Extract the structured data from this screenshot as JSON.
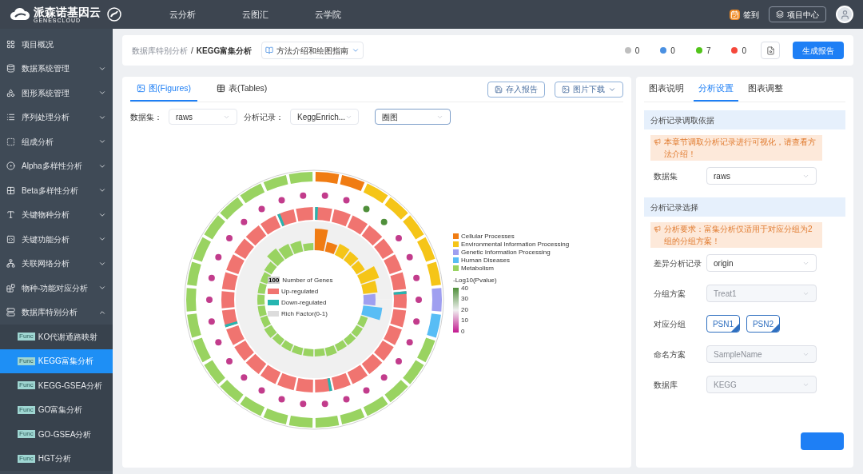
{
  "header": {
    "logo_text": "派森诺基因云",
    "logo_sub": "GENESCLOUD",
    "nav": [
      "云分析",
      "云图汇",
      "云学院"
    ],
    "sign_in": "签到",
    "project_center": "项目中心"
  },
  "sidebar": {
    "items": [
      {
        "kind": "link",
        "label": "项目概况"
      },
      {
        "kind": "group",
        "label": "数据系统管理",
        "expanded": false
      },
      {
        "kind": "group",
        "label": "图形系统管理",
        "expanded": false
      },
      {
        "kind": "group",
        "label": "序列处理分析",
        "expanded": false
      },
      {
        "kind": "group",
        "label": "组成分析",
        "expanded": false
      },
      {
        "kind": "group",
        "label": "Alpha多样性分析",
        "expanded": false
      },
      {
        "kind": "group",
        "label": "Beta多样性分析",
        "expanded": false
      },
      {
        "kind": "group",
        "label": "关键物种分析",
        "expanded": false
      },
      {
        "kind": "group",
        "label": "关键功能分析",
        "expanded": false
      },
      {
        "kind": "group",
        "label": "关联网络分析",
        "expanded": false
      },
      {
        "kind": "group",
        "label": "物种-功能对应分析",
        "expanded": false
      },
      {
        "kind": "group",
        "label": "数据库特别分析",
        "expanded": true,
        "children": [
          {
            "badge": "Func",
            "label": "KO代谢通路映射",
            "selected": false
          },
          {
            "badge": "Func",
            "label": "KEGG富集分析",
            "selected": true
          },
          {
            "badge": "Func",
            "label": "KEGG-GSEA分析",
            "selected": false
          },
          {
            "badge": "Func",
            "label": "GO富集分析",
            "selected": false
          },
          {
            "badge": "Func",
            "label": "GO-GSEA分析",
            "selected": false
          },
          {
            "badge": "Func",
            "label": "HGT分析",
            "selected": false
          }
        ]
      }
    ]
  },
  "breadcrumb": {
    "parent": "数据库特别分析",
    "separator": "/",
    "current": "KEGG富集分析",
    "guide": "方法介绍和绘图指南",
    "status": [
      {
        "color": "#bfbfbf",
        "count": "0"
      },
      {
        "color": "#4a90e2",
        "count": "0"
      },
      {
        "color": "#52c41a",
        "count": "7"
      },
      {
        "color": "#f5483b",
        "count": "0"
      }
    ],
    "generate": "生成报告"
  },
  "main": {
    "tabs": [
      {
        "label": "图(Figures)",
        "selected": true
      },
      {
        "label": "表(Tables)",
        "selected": false
      }
    ],
    "save": "存入报告",
    "download": "图片下载",
    "filters": [
      {
        "label": "数据集：",
        "value": "raws",
        "focused": false
      },
      {
        "label": "分析记录：",
        "value": "KeggEnrich...",
        "focused": false
      },
      {
        "value": "圈图",
        "focused": true
      }
    ],
    "chart": {
      "center_legend": [
        {
          "kind": "count",
          "swatch": "100",
          "label": "Number of Genes"
        },
        {
          "kind": "box",
          "color": "#f07470",
          "label": "Up-regulated"
        },
        {
          "kind": "box",
          "color": "#26b5b0",
          "label": "Down-regulated"
        },
        {
          "kind": "box",
          "color": "#dcdcdc",
          "label": "Rich Factor(0-1)"
        }
      ],
      "categories": [
        {
          "label": "Cellular Processes",
          "color": "#f07c13"
        },
        {
          "label": "Environmental Information Processing",
          "color": "#f5c518"
        },
        {
          "label": "Genetic Information Processing",
          "color": "#9f9ff0"
        },
        {
          "label": "Human Diseases",
          "color": "#58bdf5"
        },
        {
          "label": "Metabolism",
          "color": "#99d361"
        }
      ],
      "scale_title": "-Log10(Pvalue)",
      "scale_ticks": [
        "40",
        "30",
        "20",
        "10",
        "0"
      ]
    }
  },
  "panel": {
    "tabs": [
      {
        "label": "图表说明",
        "selected": false
      },
      {
        "label": "分析设置",
        "selected": true
      },
      {
        "label": "图表调整",
        "selected": false
      }
    ],
    "sections": [
      {
        "title": "分析记录调取依据",
        "notice": "本章节调取分析记录进行可视化，请查看方法介绍！",
        "fields": [
          {
            "kind": "select",
            "label": "数据集",
            "value": "raws",
            "disabled": false
          }
        ]
      },
      {
        "title": "分析记录选择",
        "notice": "分析要求：富集分析仅适用于对应分组为2组的分组方案！",
        "fields": [
          {
            "kind": "select",
            "label": "差异分析记录",
            "value": "origin",
            "disabled": false
          },
          {
            "kind": "select",
            "label": "分组方案",
            "value": "Treat1",
            "disabled": true
          },
          {
            "kind": "chips",
            "label": "对应分组",
            "chips": [
              {
                "label": "PSN1",
                "checked": true
              },
              {
                "label": "PSN2",
                "checked": true
              }
            ]
          },
          {
            "kind": "select",
            "label": "命名方案",
            "value": "SampleName",
            "disabled": true
          },
          {
            "kind": "select",
            "label": "数据库",
            "value": "KEGG",
            "disabled": true
          }
        ]
      }
    ]
  }
}
